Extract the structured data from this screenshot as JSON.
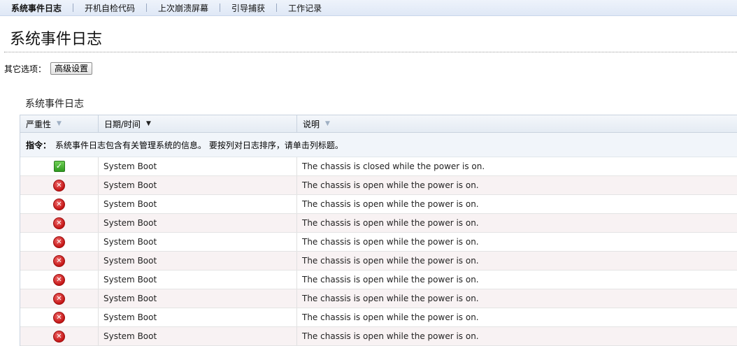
{
  "tabs": [
    {
      "label": "系统事件日志",
      "active": true
    },
    {
      "label": "开机自检代码",
      "active": false
    },
    {
      "label": "上次崩溃屏幕",
      "active": false
    },
    {
      "label": "引导捕获",
      "active": false
    },
    {
      "label": "工作记录",
      "active": false
    }
  ],
  "page_title": "系统事件日志",
  "options": {
    "label": "其它选项：",
    "advanced_button": "高级设置"
  },
  "section_title": "系统事件日志",
  "table": {
    "columns": [
      {
        "label": "严重性",
        "sort_icon": "sort-arrow-icon"
      },
      {
        "label": "日期/时间",
        "sort_icon": "sort-desc-icon"
      },
      {
        "label": "说明",
        "sort_icon": "sort-arrow-icon"
      }
    ],
    "hint_label": "指令：",
    "hint_text": "系统事件日志包含有关管理系统的信息。 要按列对日志排序，请单击列标题。",
    "rows": [
      {
        "severity": "ok",
        "datetime": "System Boot",
        "description": "The chassis is closed while the power is on."
      },
      {
        "severity": "critical",
        "datetime": "System Boot",
        "description": "The chassis is open while the power is on."
      },
      {
        "severity": "critical",
        "datetime": "System Boot",
        "description": "The chassis is open while the power is on."
      },
      {
        "severity": "critical",
        "datetime": "System Boot",
        "description": "The chassis is open while the power is on."
      },
      {
        "severity": "critical",
        "datetime": "System Boot",
        "description": "The chassis is open while the power is on."
      },
      {
        "severity": "critical",
        "datetime": "System Boot",
        "description": "The chassis is open while the power is on."
      },
      {
        "severity": "critical",
        "datetime": "System Boot",
        "description": "The chassis is open while the power is on."
      },
      {
        "severity": "critical",
        "datetime": "System Boot",
        "description": "The chassis is open while the power is on."
      },
      {
        "severity": "critical",
        "datetime": "System Boot",
        "description": "The chassis is open while the power is on."
      },
      {
        "severity": "critical",
        "datetime": "System Boot",
        "description": "The chassis is open while the power is on."
      }
    ]
  }
}
